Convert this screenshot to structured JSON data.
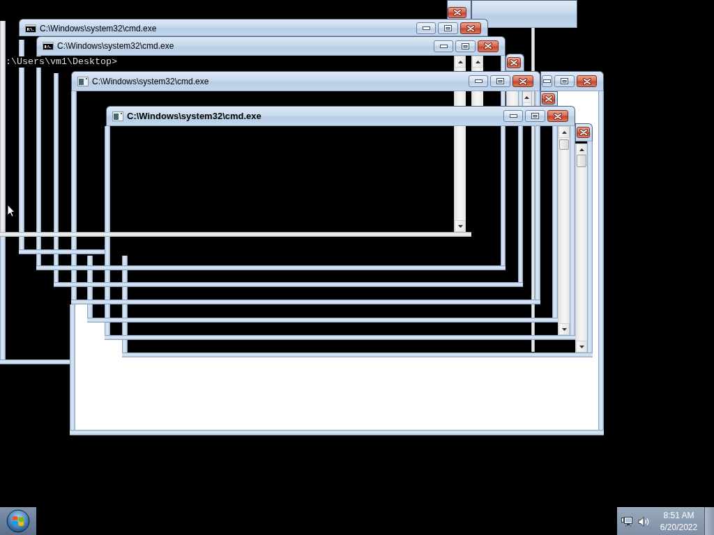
{
  "windows": [
    {
      "title": "C:\\Windows\\system32\\cmd.exe",
      "kind": "console",
      "active": false
    },
    {
      "title": "C:\\Windows\\system32\\cmd.exe",
      "kind": "console",
      "active": false
    },
    {
      "title": "C:\\Windows\\system32\\cmd.exe",
      "kind": "generic",
      "active": false
    },
    {
      "title": "C:\\Windows\\system32\\cmd.exe",
      "kind": "generic",
      "active": true
    }
  ],
  "console": {
    "lines": [
      ":\\Users\\vm1\\Desktop>"
    ]
  },
  "taskbar": {
    "clock": {
      "time": "8:51 AM",
      "date": "6/20/2022"
    }
  }
}
